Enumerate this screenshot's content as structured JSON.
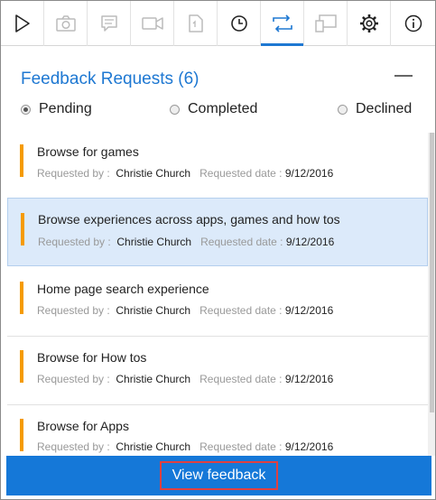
{
  "toolbar": {
    "buttons": [
      {
        "icon": "play-icon",
        "enabled": true
      },
      {
        "icon": "camera-icon",
        "enabled": false
      },
      {
        "icon": "note-icon",
        "enabled": false
      },
      {
        "icon": "video-icon",
        "enabled": false
      },
      {
        "icon": "document-icon",
        "enabled": false
      },
      {
        "icon": "clock-icon",
        "enabled": true
      },
      {
        "icon": "feedback-request-icon",
        "enabled": true,
        "active": true
      },
      {
        "icon": "cast-icon",
        "enabled": false
      },
      {
        "icon": "gear-icon",
        "enabled": true
      },
      {
        "icon": "info-icon",
        "enabled": true
      }
    ],
    "accent_color": "#1e78d2"
  },
  "panel": {
    "title": "Feedback Requests (6)"
  },
  "filters": [
    {
      "label": "Pending",
      "checked": true
    },
    {
      "label": "Completed",
      "checked": false
    },
    {
      "label": "Declined",
      "checked": false
    }
  ],
  "list": {
    "requested_by_label": "Requested by :",
    "requested_date_label": "Requested date :",
    "items": [
      {
        "title": "Browse for games",
        "requester": "Christie Church",
        "date": "9/12/2016",
        "selected": false
      },
      {
        "title": "Browse experiences across apps, games and how tos",
        "requester": "Christie Church",
        "date": "9/12/2016",
        "selected": true
      },
      {
        "title": "Home page search experience",
        "requester": "Christie Church",
        "date": "9/12/2016",
        "selected": false
      },
      {
        "title": "Browse for How tos",
        "requester": "Christie Church",
        "date": "9/12/2016",
        "selected": false
      },
      {
        "title": "Browse for Apps",
        "requester": "Christie Church",
        "date": "9/12/2016",
        "selected": false
      }
    ],
    "priority_color": "#f59b00",
    "selected_color": "#dceafa"
  },
  "action": {
    "label": "View feedback",
    "bar_color": "#1578d8"
  }
}
